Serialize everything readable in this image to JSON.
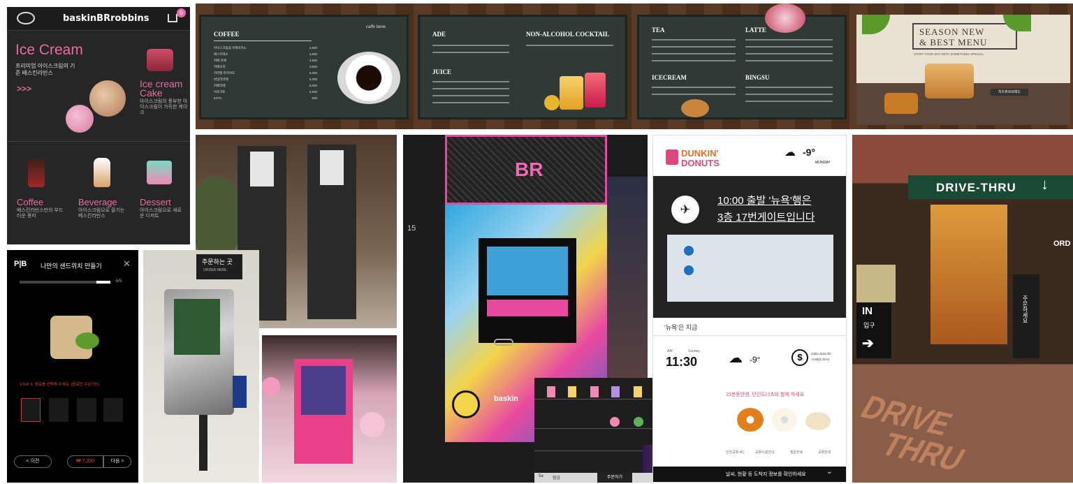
{
  "baskin_app": {
    "brand": "baskinBRrobbins",
    "cart_count": "0",
    "hero_title": "Ice Cream",
    "hero_subtitle": "프리미엄 아이스크림의 기준 배스킨라빈스",
    "hero_arrow": ">>>",
    "cake_label": "Ice cream Cake",
    "cake_desc": "아이스크림의 풍부한 아이스크림이 가득한 케이크",
    "categories": [
      {
        "label": "Coffee",
        "desc": "배스킨라빈스만의 부드러운 풍미"
      },
      {
        "label": "Beverage",
        "desc": "아이스크림으로 즐기는 베스킨라빈스"
      },
      {
        "label": "Dessert",
        "desc": "아이스크림으로 새로운 디저트"
      }
    ]
  },
  "menu_boards": {
    "coffee_header": "COFFEE",
    "logo_text": "caffe bene",
    "ade_header": "ADE",
    "juice_header": "JUICE",
    "nonalcohol_header": "NON-ALCOHOL COCKTAIL",
    "tea_header": "TEA",
    "latte_header": "LATTE",
    "icecream_header": "ICECREAM",
    "bingsu_header": "BINGSU",
    "season_title_1": "SEASON NEW",
    "season_title_2": "& BEST MENU",
    "season_sub": "START YOUR DAY WITH SOMETHING SPECIAL",
    "season_item": "치즈츄르브레드",
    "coffee_items": [
      "아이스크림을 아메리카노",
      "에스프레소",
      "카페 라떼",
      "카페모카",
      "카라멜 마끼아또",
      "바닐라라떼",
      "카페라떼",
      "아포가토",
      "ESTA"
    ],
    "coffee_prices": [
      "4,500",
      "4,500",
      "4,500",
      "4,500",
      "5,000",
      "5,000",
      "5,000",
      "5,500",
      "500"
    ]
  },
  "sandwich_kiosk": {
    "logo": "P|B",
    "title": "나만의 샌드위치 만들기",
    "step_indicator": "5/5",
    "step_text": "STEP 5. 음료를 선택해 주세요. (음료만 주문가능)",
    "prev_button": "< 이전",
    "price": "₩ 7,300",
    "next_button": "다음 >"
  },
  "order_kiosk": {
    "sign": "주문하는 곳",
    "sign_sub": "ORDER HERE"
  },
  "br_machine": {
    "logo": "BR",
    "side_number": "15",
    "brand": "baskin"
  },
  "dunkin": {
    "brand_1": "DUNKIN'",
    "brand_2": "DONUTS",
    "temp_top": "-9°",
    "day": "MONDAY",
    "flight_line_1": "10:00 출발 '뉴욕'행은",
    "flight_line_2": "3층 17번게이트입니다",
    "now_label": "'뉴욕'은 지금",
    "ampm": "AM",
    "weekday": "Sunday",
    "time": "11:30",
    "temp_bottom": "-9°",
    "usd_line_1": "USD=1142.40",
    "usd_line_2": "-3.60(0.31%)",
    "promo": "15분동안엔, 던킨도너츠와 함께 하세요",
    "nav_items": [
      "인천공항 AC",
      "공항시설안내",
      "행운번호",
      "공항안내"
    ],
    "ticker": "날씨, 현황 등 도착지 정보를 확인하세요"
  },
  "drive_thru": {
    "sign": "DRIVE-THRU",
    "in_label": "IN",
    "in_korean": "입구",
    "ground_1": "DRIVE",
    "ground_2": "THRU",
    "pillar_text": "주문하세요",
    "right_sign": "ORD"
  },
  "vending": {
    "bottom_labels": [
      "5a",
      "잠금",
      "",
      "",
      "주문하기"
    ]
  }
}
